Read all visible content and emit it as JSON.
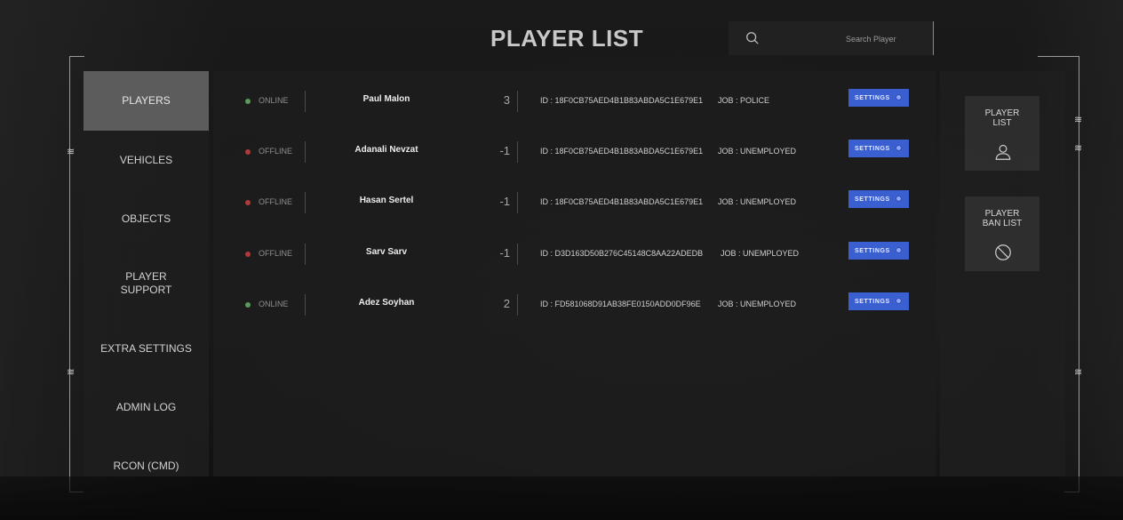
{
  "header": {
    "title": "PLAYER LIST",
    "search_placeholder": "Search Player",
    "search_value": ""
  },
  "sidebar": {
    "items": [
      {
        "label": "PLAYERS",
        "active": true
      },
      {
        "label": "VEHICLES",
        "active": false
      },
      {
        "label": "OBJECTS",
        "active": false
      },
      {
        "label": "PLAYER\nSUPPORT",
        "active": false
      },
      {
        "label": "EXTRA SETTINGS",
        "active": false
      },
      {
        "label": "ADMIN LOG",
        "active": false
      },
      {
        "label": "RCON (CMD)",
        "active": false
      }
    ]
  },
  "players": [
    {
      "status": "ONLINE",
      "status_color": "#5b9a5b",
      "name": "Paul Malon",
      "number": "3",
      "id": "ID : 18F0CB75AED4B1B83ABDA5C1E679E1",
      "job": "JOB : POLICE",
      "settings_label": "SETTINGS"
    },
    {
      "status": "OFFLINE",
      "status_color": "#b03a3a",
      "name": "Adanali Nevzat",
      "number": "-1",
      "id": "ID : 18F0CB75AED4B1B83ABDA5C1E679E1",
      "job": "JOB : UNEMPLOYED",
      "settings_label": "SETTINGS"
    },
    {
      "status": "OFFLINE",
      "status_color": "#b03a3a",
      "name": "Hasan Sertel",
      "number": "-1",
      "id": "ID : 18F0CB75AED4B1B83ABDA5C1E679E1",
      "job": "JOB : UNEMPLOYED",
      "settings_label": "SETTINGS"
    },
    {
      "status": "OFFLINE",
      "status_color": "#b03a3a",
      "name": "Sarv Sarv",
      "number": "-1",
      "id": "ID : D3D163D50B276C45148C8AA22ADEDB",
      "job": "JOB : UNEMPLOYED",
      "settings_label": "SETTINGS"
    },
    {
      "status": "ONLINE",
      "status_color": "#5b9a5b",
      "name": "Adez Soyhan",
      "number": "2",
      "id": "ID : FD581068D91AB38FE0150ADD0DF96E",
      "job": "JOB : UNEMPLOYED",
      "settings_label": "SETTINGS"
    }
  ],
  "right_panel": {
    "cards": [
      {
        "label": "PLAYER\nLIST",
        "icon": "user-icon"
      },
      {
        "label": "PLAYER\nBAN LIST",
        "icon": "ban-icon"
      }
    ]
  },
  "colors": {
    "accent": "#3a5fd0",
    "online": "#5b9a5b",
    "offline": "#b03a3a"
  }
}
